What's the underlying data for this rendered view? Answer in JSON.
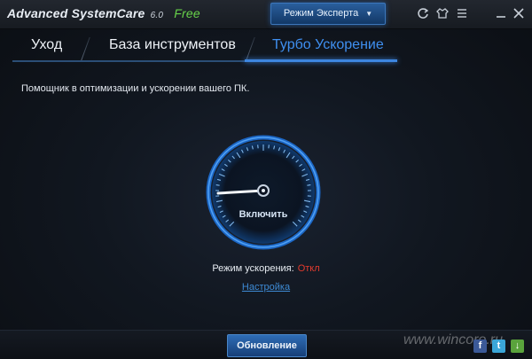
{
  "titlebar": {
    "app_name": "Advanced SystemCare",
    "version": "6.0",
    "edition": "Free",
    "mode_button": "Режим Эксперта",
    "icons": [
      "refresh-icon",
      "shirt-skin-icon",
      "menu-icon",
      "minimize-icon",
      "close-icon"
    ]
  },
  "tabs": [
    {
      "label": "Уход"
    },
    {
      "label": "База инструментов"
    },
    {
      "label": "Турбо Ускорение",
      "active": true
    }
  ],
  "subtitle": "Помощник в оптимизации и ускорении вашего ПК.",
  "gauge": {
    "button_label": "Включить"
  },
  "mode": {
    "label": "Режим ускорения:",
    "value": "Откл"
  },
  "settings_link": "Настройка",
  "footer": {
    "update_button": "Обновление",
    "watermark": "www.wincore.ru",
    "social": [
      "facebook-icon",
      "twitter-icon",
      "download-icon"
    ]
  },
  "colors": {
    "accent": "#3d86e0",
    "free": "#67d24a",
    "off": "#e23b2e",
    "link": "#3e8bd6"
  }
}
